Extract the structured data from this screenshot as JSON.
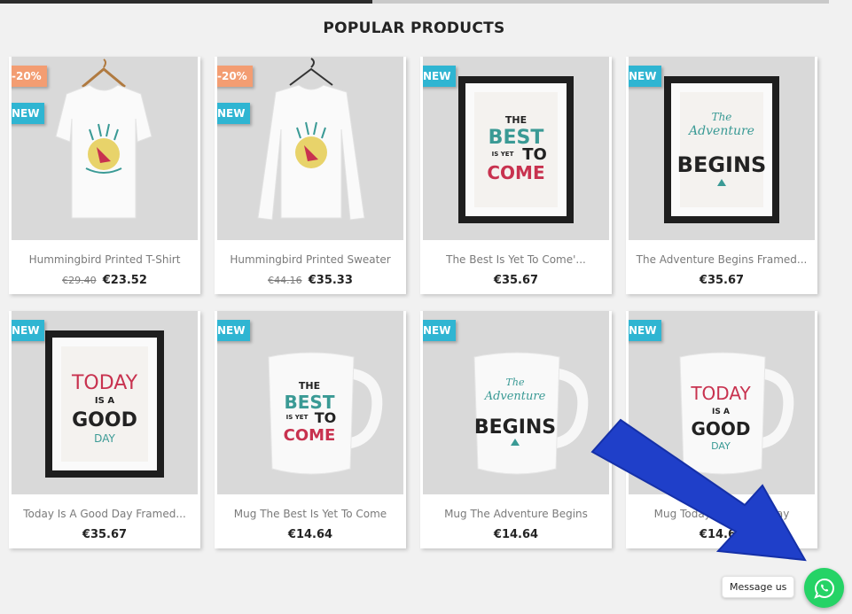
{
  "section": {
    "title": "POPULAR PRODUCTS"
  },
  "flags": {
    "new": "NEW"
  },
  "products": [
    {
      "name": "Hummingbird Printed T-Shirt",
      "old_price": "€29.40",
      "price": "€23.52",
      "discount": "-20%",
      "art": "tshirt"
    },
    {
      "name": "Hummingbird Printed Sweater",
      "old_price": "€44.16",
      "price": "€35.33",
      "discount": "-20%",
      "art": "sweater"
    },
    {
      "name": "The Best Is Yet To Come'...",
      "old_price": "",
      "price": "€35.67",
      "discount": "",
      "art": "frame-best"
    },
    {
      "name": "The Adventure Begins Framed...",
      "old_price": "",
      "price": "€35.67",
      "discount": "",
      "art": "frame-adventure"
    },
    {
      "name": "Today Is A Good Day Framed...",
      "old_price": "",
      "price": "€35.67",
      "discount": "",
      "art": "frame-today"
    },
    {
      "name": "Mug The Best Is Yet To Come",
      "old_price": "",
      "price": "€14.64",
      "discount": "",
      "art": "mug-best"
    },
    {
      "name": "Mug The Adventure Begins",
      "old_price": "",
      "price": "€14.64",
      "discount": "",
      "art": "mug-adventure"
    },
    {
      "name": "Mug Today Is A Good Day",
      "old_price": "",
      "price": "€14.64",
      "discount": "",
      "art": "mug-today"
    }
  ],
  "artwork": {
    "best": [
      "THE",
      "BEST",
      "IS YET",
      "TO",
      "COME"
    ],
    "adventure": [
      "The",
      "Adventure",
      "BEGINS"
    ],
    "today": [
      "TODAY",
      "IS A",
      "GOOD",
      "DAY"
    ]
  },
  "chat": {
    "bubble": "Message us",
    "partial_text": "ts",
    "icon": "whatsapp-icon",
    "color": "#25d366"
  },
  "annotation": {
    "arrow_color": "#1f3fc9"
  }
}
